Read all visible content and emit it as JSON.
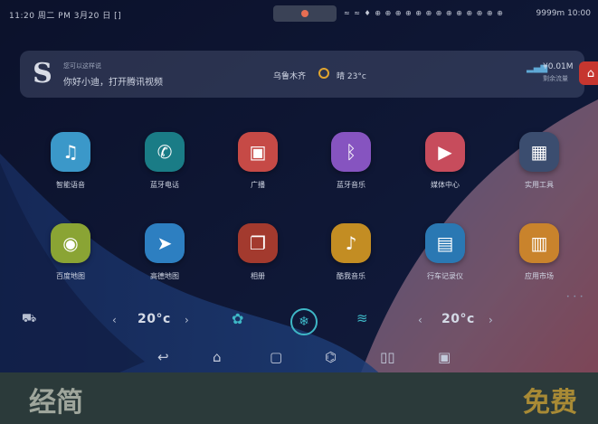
{
  "status_bar": {
    "left_text": "11:20 周二 PM 3月20 日 [] ",
    "icons_text": "≈ ≈ ♦ ⊕ ⊕ ⊕ ⊕ ⊕ ⊕ ⊕ ⊕ ⊕ ⊕ ⊕ ⊕ ⊕",
    "right_text": "9999m 10:00"
  },
  "info_card": {
    "logo_glyph": "S",
    "greeting_sub": "您可以这样说",
    "greeting_main": "你好小迪，打开腾讯视频",
    "weather_city": "乌鲁木齐",
    "weather_text": "晴 23°c",
    "data_value": "¥0.01M",
    "data_sub": "剩余流量"
  },
  "apps": [
    {
      "label": "智能语音",
      "icon": "voice-wave-icon",
      "glyph": "♫",
      "color": "#3b98c9"
    },
    {
      "label": "蓝牙电话",
      "icon": "phone-icon",
      "glyph": "✆",
      "color": "#1a7c86"
    },
    {
      "label": "广播",
      "icon": "radio-icon",
      "glyph": "▣",
      "color": "#c64a46"
    },
    {
      "label": "蓝牙音乐",
      "icon": "bluetooth-icon",
      "glyph": "ᛒ",
      "color": "#8654c0"
    },
    {
      "label": "媒体中心",
      "icon": "play-icon",
      "glyph": "▶",
      "color": "#c74c5c"
    },
    {
      "label": "实用工具",
      "icon": "tools-grid-icon",
      "glyph": "▦",
      "color": "#3b4d6f"
    },
    {
      "label": "百度地图",
      "icon": "map-pin-icon",
      "glyph": "◉",
      "color": "#8aa434"
    },
    {
      "label": "高德地图",
      "icon": "paper-plane-icon",
      "glyph": "➤",
      "color": "#2d7fc1"
    },
    {
      "label": "相册",
      "icon": "photo-icon",
      "glyph": "❐",
      "color": "#a33a2e"
    },
    {
      "label": "酷我音乐",
      "icon": "music-box-icon",
      "glyph": "♪",
      "color": "#c38d23"
    },
    {
      "label": "行车记录仪",
      "icon": "dashcam-icon",
      "glyph": "▤",
      "color": "#2a78b3"
    },
    {
      "label": "应用市场",
      "icon": "store-icon",
      "glyph": "▥",
      "color": "#c9832c"
    }
  ],
  "page_dots": "• • •",
  "control_bar": {
    "car_icon": "car-icon",
    "left_temp": "20°c",
    "right_temp": "20°c",
    "fan_icon": "fan-icon",
    "ac_icon": "ac-icon",
    "defrost_icon": "defrost-icon",
    "prev": "‹",
    "next": "›"
  },
  "nav_bar": {
    "back": "↩",
    "home": "⌂",
    "recent": "▢",
    "settings": "⌬",
    "split": "▯▯",
    "screenshot": "▣"
  },
  "banner": {
    "left": "经简",
    "right": "免费"
  },
  "colors": {
    "accent": "#3eb7c6",
    "sun": "#e1a52e",
    "shop": "#c6362f"
  }
}
